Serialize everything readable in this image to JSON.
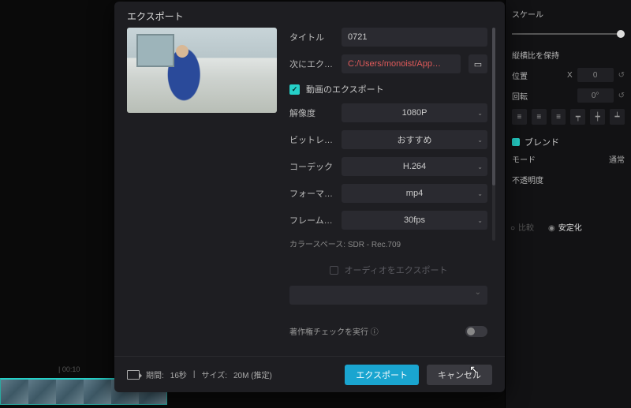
{
  "modal": {
    "title": "エクスポート",
    "fields": {
      "title_label": "タイトル",
      "title_value": "0721",
      "path_label": "次にエク…",
      "path_value": "C:/Users/monoist/App…"
    },
    "video_section": {
      "header": "動画のエクスポート",
      "resolution_label": "解像度",
      "resolution_value": "1080P",
      "bitrate_label": "ビットレート",
      "bitrate_value": "おすすめ",
      "codec_label": "コーデック",
      "codec_value": "H.264",
      "format_label": "フォーマット",
      "format_value": "mp4",
      "framerate_label": "フレーム…",
      "framerate_value": "30fps",
      "colorspace": "カラースペース: SDR - Rec.709"
    },
    "audio_section": {
      "header": "オーディオをエクスポート"
    },
    "copyright": {
      "label": "著作権チェックを実行 ⓘ"
    },
    "footer": {
      "duration_label": "期間:",
      "duration_value": "16秒",
      "size_label": "サイズ:",
      "size_value": "20M (推定)",
      "export_btn": "エクスポート",
      "cancel_btn": "キャンセル"
    }
  },
  "bg_panel": {
    "scale_label": "スケール",
    "keep_ratio": "縦横比を保持",
    "position_label": "位置",
    "position_x": "X",
    "position_x_val": "0",
    "rotation_label": "回転",
    "rotation_val": "0°",
    "blend_header": "ブレンド",
    "mode_label": "モード",
    "mode_value": "通常",
    "opacity_label": "不透明度",
    "tab_compare": "比較",
    "tab_stabilize": "安定化"
  },
  "timeline": {
    "mark1": "| 00:10",
    "crop_icon": "▢"
  }
}
